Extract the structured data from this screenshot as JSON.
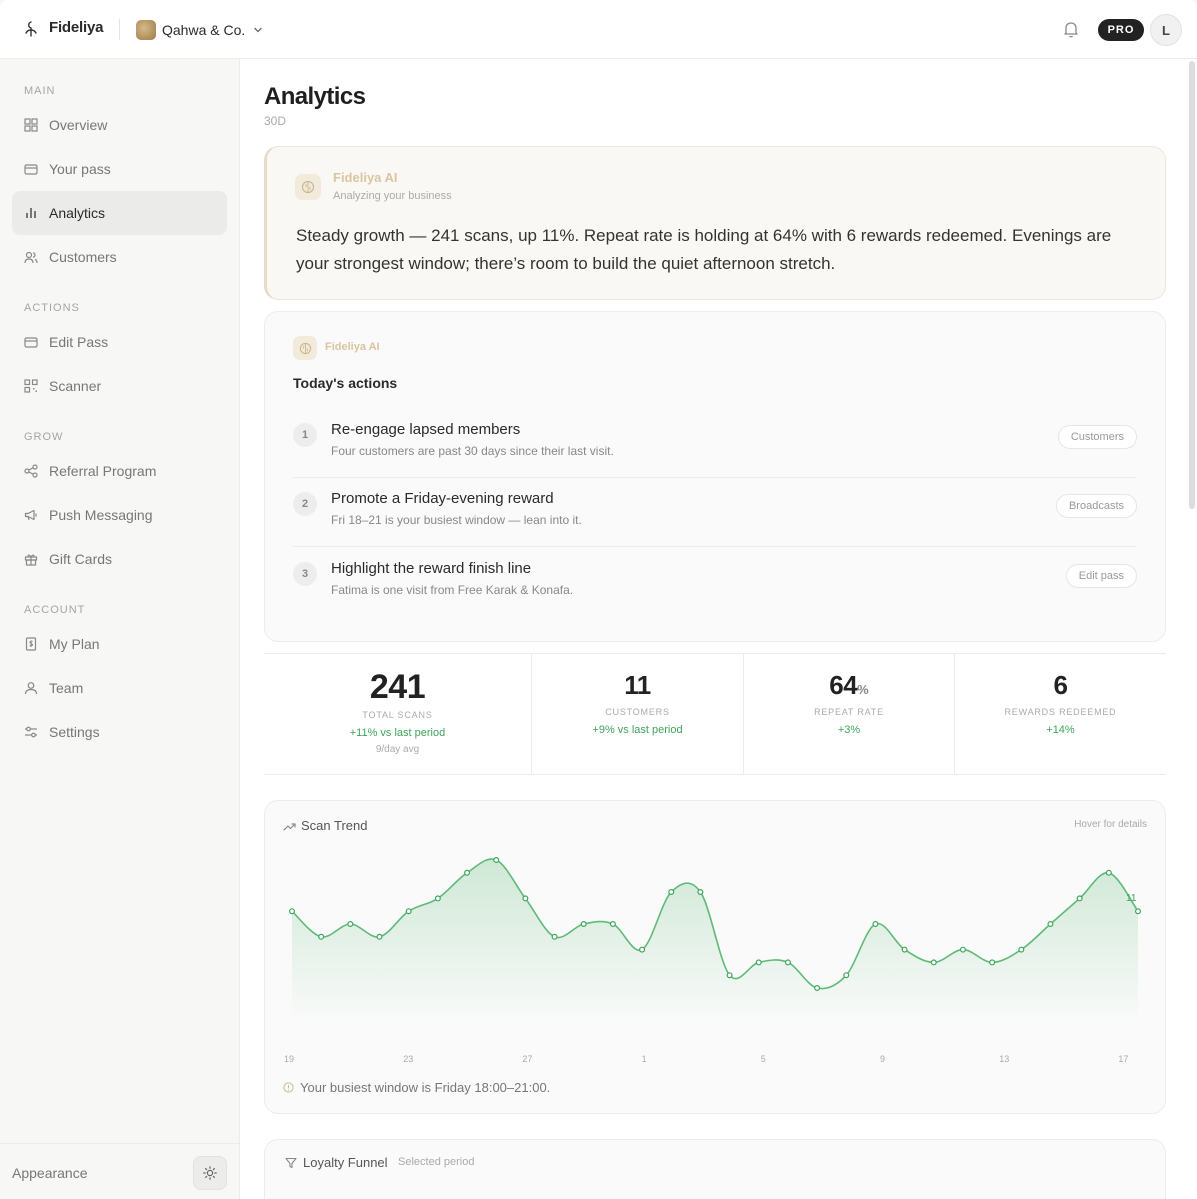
{
  "app": {
    "brand": "Fideliya"
  },
  "business": {
    "name": "Qahwa & Co."
  },
  "header": {
    "pro_label": "PRO",
    "user_initial": "L"
  },
  "sidebar": {
    "sections": [
      {
        "label": "MAIN",
        "items": [
          {
            "label": "Overview",
            "icon": "grid-icon"
          },
          {
            "label": "Your pass",
            "icon": "card-icon"
          },
          {
            "label": "Analytics",
            "icon": "bar-chart-icon",
            "active": true
          },
          {
            "label": "Customers",
            "icon": "users-icon"
          }
        ]
      },
      {
        "label": "ACTIONS",
        "items": [
          {
            "label": "Edit Pass",
            "icon": "card-icon"
          },
          {
            "label": "Scanner",
            "icon": "qr-icon"
          }
        ]
      },
      {
        "label": "GROW",
        "items": [
          {
            "label": "Referral Program",
            "icon": "share-icon"
          },
          {
            "label": "Push Messaging",
            "icon": "megaphone-icon"
          },
          {
            "label": "Gift Cards",
            "icon": "gift-icon"
          }
        ]
      },
      {
        "label": "ACCOUNT",
        "items": [
          {
            "label": "My Plan",
            "icon": "receipt-icon"
          },
          {
            "label": "Team",
            "icon": "user-icon"
          },
          {
            "label": "Settings",
            "icon": "sliders-icon"
          }
        ]
      }
    ],
    "appearance_label": "Appearance"
  },
  "page": {
    "title": "Analytics",
    "period": "30D"
  },
  "insight": {
    "title": "Fideliya AI",
    "subtitle": "Analyzing your business",
    "text": "Steady growth — 241 scans, up 11%. Repeat rate is holding at 64% with 6 rewards redeemed. Evenings are your strongest window; there’s room to build the quiet afternoon stretch."
  },
  "actions": {
    "ai_label": "Fideliya AI",
    "heading": "Today's actions",
    "items": [
      {
        "num": "1",
        "title": "Re-engage lapsed members",
        "desc": "Four customers are past 30 days since their last visit.",
        "button": "Customers"
      },
      {
        "num": "2",
        "title": "Promote a Friday-evening reward",
        "desc": "Fri 18–21 is your busiest window — lean into it.",
        "button": "Broadcasts"
      },
      {
        "num": "3",
        "title": "Highlight the reward finish line",
        "desc": "Fatima is one visit from Free Karak & Konafa.",
        "button": "Edit pass"
      }
    ]
  },
  "stats": [
    {
      "value": "241",
      "unit": "",
      "label": "TOTAL SCANS",
      "change": "+11% vs last period",
      "extra": "9/day avg"
    },
    {
      "value": "11",
      "unit": "",
      "label": "CUSTOMERS",
      "change": "+9% vs last period",
      "extra": ""
    },
    {
      "value": "64",
      "unit": "%",
      "label": "REPEAT RATE",
      "change": "+3%",
      "extra": ""
    },
    {
      "value": "6",
      "unit": "",
      "label": "REWARDS REDEEMED",
      "change": "+14%",
      "extra": ""
    }
  ],
  "trend": {
    "title": "Scan Trend",
    "hint": "Hover for details",
    "note": "Your busiest window is Friday 18:00–21:00.",
    "last_value_label": "11"
  },
  "chart_data": {
    "type": "area",
    "title": "Scan Trend",
    "x_tick_labels": [
      "19",
      "23",
      "27",
      "1",
      "5",
      "9",
      "13",
      "17"
    ],
    "values": [
      9,
      7,
      8,
      7,
      9,
      10,
      12,
      13,
      10,
      7,
      8,
      8,
      6,
      10.5,
      10.5,
      4,
      5,
      5,
      3,
      4,
      8,
      6,
      5,
      6,
      5,
      6,
      8,
      10,
      12,
      9
    ],
    "grid": false,
    "legend": "none"
  },
  "funnel": {
    "title": "Loyalty Funnel",
    "subtitle": "Selected period"
  },
  "colors": {
    "accent_green": "#5fba78",
    "positive": "#3fa45a",
    "ai_gold": "#d8c6a0"
  }
}
